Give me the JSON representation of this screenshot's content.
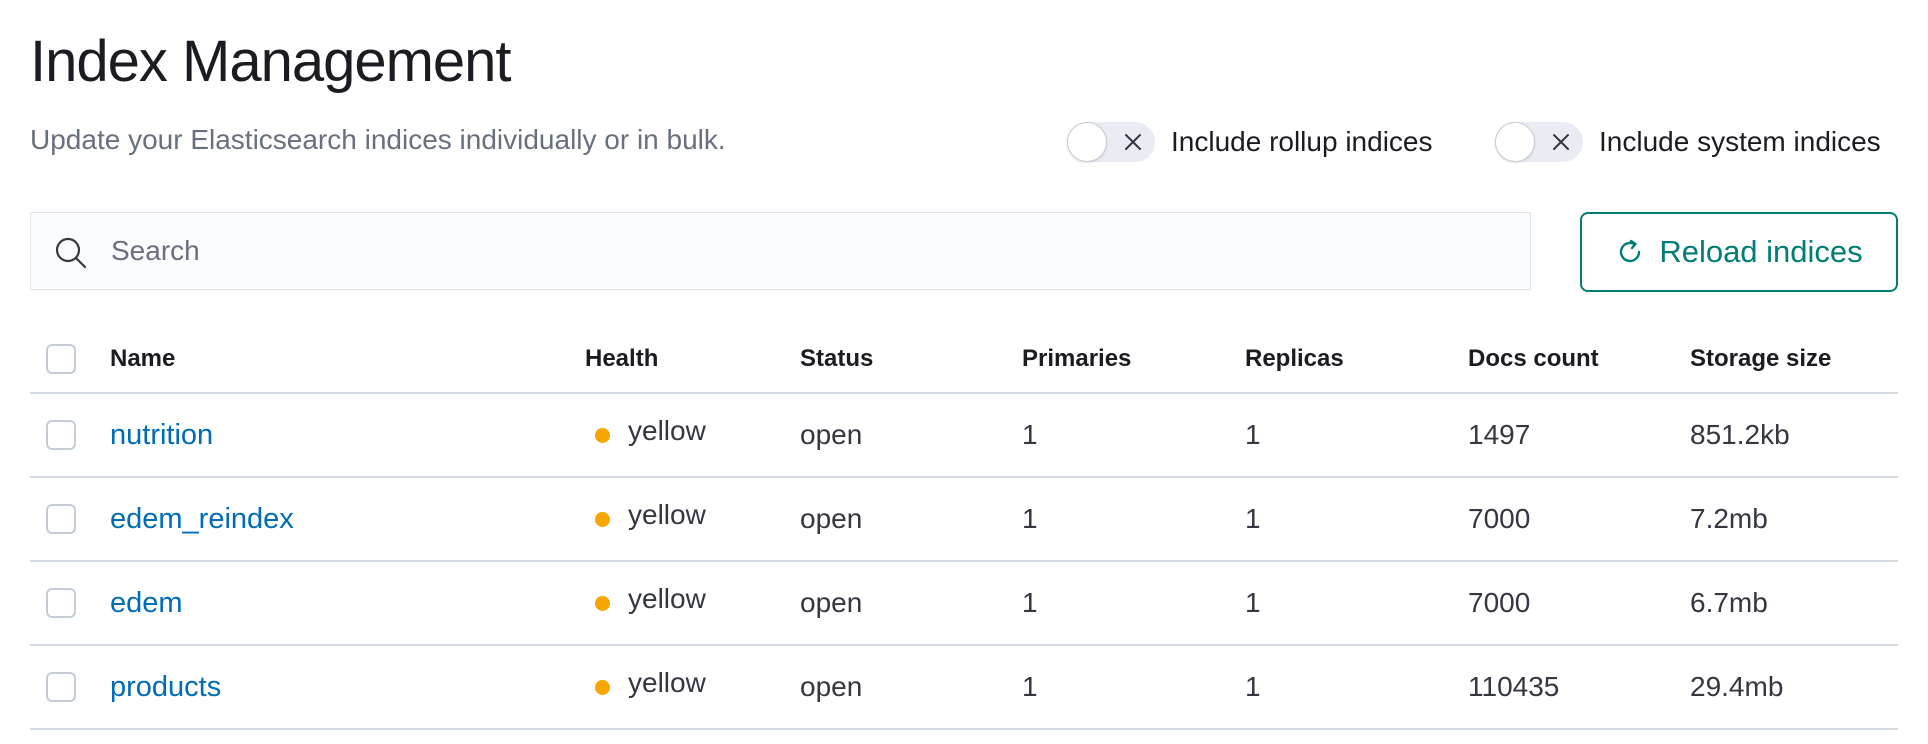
{
  "header": {
    "title": "Index Management",
    "subtitle": "Update your Elasticsearch indices individually or in bulk."
  },
  "toggles": {
    "rollup": {
      "label": "Include rollup indices",
      "checked": false
    },
    "system": {
      "label": "Include system indices",
      "checked": false
    }
  },
  "search": {
    "placeholder": "Search",
    "value": ""
  },
  "toolbar": {
    "reload_label": "Reload indices",
    "accent_color": "#017d73"
  },
  "table": {
    "columns": {
      "name": "Name",
      "health": "Health",
      "status": "Status",
      "primaries": "Primaries",
      "replicas": "Replicas",
      "docs_count": "Docs count",
      "storage_size": "Storage size"
    },
    "health_color": "#f5a700",
    "rows": [
      {
        "name": "nutrition",
        "health": "yellow",
        "status": "open",
        "primaries": "1",
        "replicas": "1",
        "docs_count": "1497",
        "storage_size": "851.2kb"
      },
      {
        "name": "edem_reindex",
        "health": "yellow",
        "status": "open",
        "primaries": "1",
        "replicas": "1",
        "docs_count": "7000",
        "storage_size": "7.2mb"
      },
      {
        "name": "edem",
        "health": "yellow",
        "status": "open",
        "primaries": "1",
        "replicas": "1",
        "docs_count": "7000",
        "storage_size": "6.7mb"
      },
      {
        "name": "products",
        "health": "yellow",
        "status": "open",
        "primaries": "1",
        "replicas": "1",
        "docs_count": "110435",
        "storage_size": "29.4mb"
      }
    ]
  }
}
